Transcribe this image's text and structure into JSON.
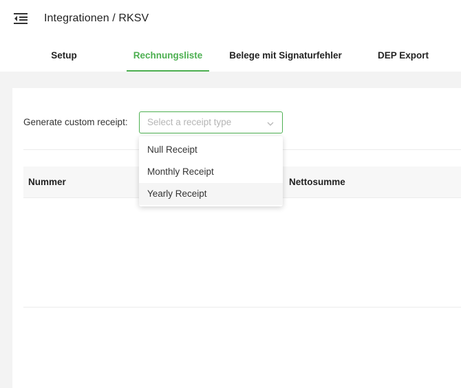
{
  "header": {
    "title": "Integrationen / RKSV",
    "menu_icon": "menu-fold-icon"
  },
  "tabs": [
    {
      "label": "Setup",
      "active": false
    },
    {
      "label": "Rechnungsliste",
      "active": true
    },
    {
      "label": "Belege mit Signaturfehler",
      "active": false
    },
    {
      "label": "DEP Export",
      "active": false
    }
  ],
  "generate": {
    "label": "Generate custom receipt:",
    "placeholder": "Select a receipt type"
  },
  "dropdown": {
    "options": [
      "Null Receipt",
      "Monthly Receipt",
      "Yearly Receipt"
    ],
    "highlighted": "Yearly Receipt"
  },
  "table": {
    "columns": [
      "Nummer",
      "Nettosumme"
    ]
  },
  "colors": {
    "accent": "#4caf50",
    "page_background": "#f3f3f3"
  }
}
